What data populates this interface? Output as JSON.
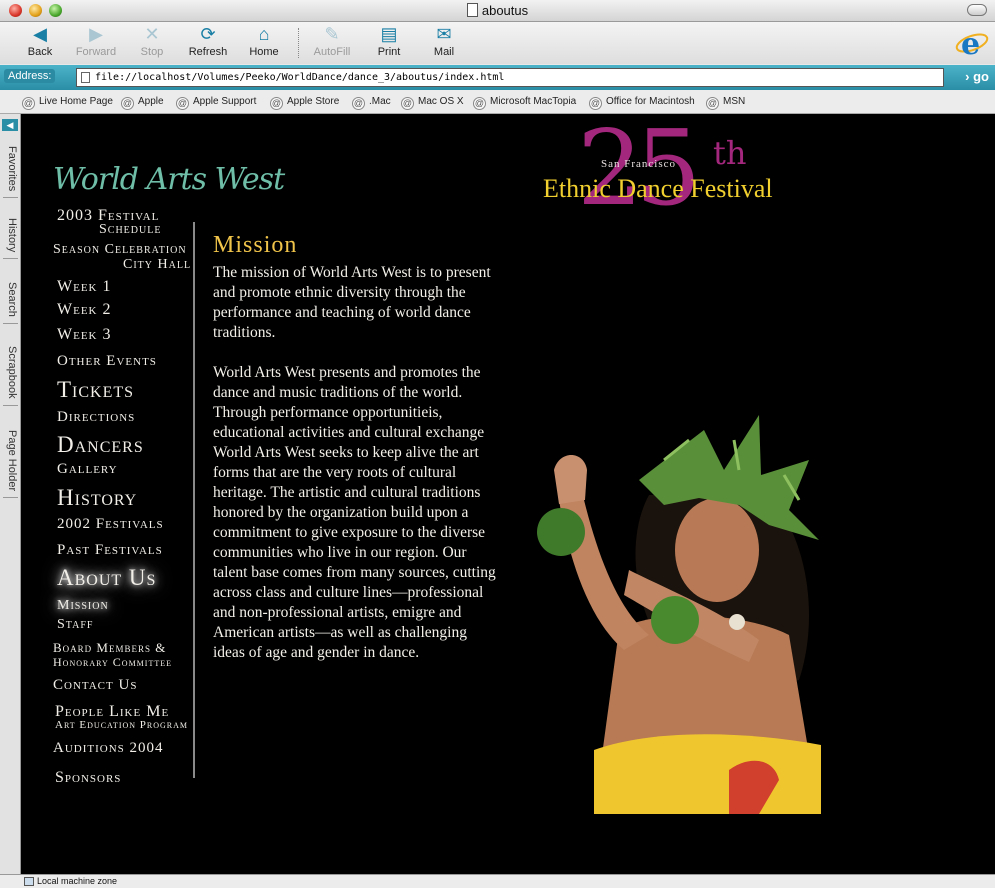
{
  "window": {
    "title": "aboutus"
  },
  "toolbar": {
    "back": "Back",
    "forward": "Forward",
    "stop": "Stop",
    "refresh": "Refresh",
    "home": "Home",
    "autofill": "AutoFill",
    "print": "Print",
    "mail": "Mail"
  },
  "address": {
    "label": "Address:",
    "url": "file://localhost/Volumes/Peeko/WorldDance/dance_3/aboutus/index.html",
    "go": "go"
  },
  "favorites": [
    "Live Home Page",
    "Apple",
    "Apple Support",
    "Apple Store",
    ".Mac",
    "Mac OS X",
    "Microsoft MacTopia",
    "Office for Macintosh",
    "MSN"
  ],
  "side_tabs": [
    "Favorites",
    "History",
    "Search",
    "Scrapbook",
    "Page Holder"
  ],
  "page": {
    "logo": "World Arts West",
    "festival": {
      "number": "25",
      "suffix": "th",
      "city": "San Francisco",
      "name": "Ethnic Dance Festival"
    },
    "nav": [
      "2003 Festival",
      "Schedule",
      "Season Celebration",
      "City Hall",
      "Week 1",
      "Week 2",
      "Week 3",
      "Other Events",
      "Tickets",
      "Directions",
      "Dancers",
      "Gallery",
      "History",
      "2002 Festivals",
      "Past Festivals",
      "About Us",
      "Mission",
      "Staff",
      "Board Members &",
      "Honorary Committee",
      "Contact Us",
      "People Like Me",
      "Art Education Program",
      "Auditions 2004",
      "Sponsors"
    ],
    "mission_title": "Mission",
    "mission_p1": "The mission of World Arts West is to present and promote ethnic diversity through the performance and teaching of world dance traditions.",
    "mission_p2": "World Arts West presents and promotes the dance and music traditions of the world.  Through performance opportunitieis, educational activities and cultural exchange World Arts West seeks to keep alive the art forms that are the very roots of cultural heritage.  The artistic and cultural traditions honored by the organization build upon a commitment to give exposure to the diverse communities who live in our region.  Our talent base comes from many sources, cutting across class and culture lines—professional and non-professional artists, emigre and American artists—as well as challenging ideas of age and gender in dance."
  },
  "status": {
    "zone": "Local machine zone"
  },
  "colors": {
    "accent": "#2a8ea6",
    "mission_title": "#f0c44a",
    "festival_magenta": "#a3287d",
    "festival_yellow": "#f0cf2e",
    "logo_green": "#6fbfa8"
  }
}
